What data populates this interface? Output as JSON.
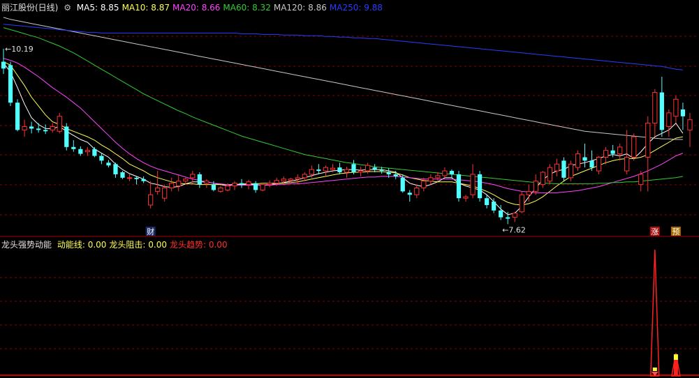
{
  "header": {
    "stock_name": "丽江股份(日线)",
    "ma": [
      {
        "label": "MA5:",
        "value": "8.85",
        "color": "#ffffff"
      },
      {
        "label": "MA10:",
        "value": "8.87",
        "color": "#ffff55"
      },
      {
        "label": "MA20:",
        "value": "8.66",
        "color": "#ff44ff"
      },
      {
        "label": "MA60:",
        "value": "8.32",
        "color": "#33cc33"
      },
      {
        "label": "MA120:",
        "value": "8.86",
        "color": "#c8c8c8"
      },
      {
        "label": "MA250:",
        "value": "9.88",
        "color": "#2a3cff"
      }
    ]
  },
  "indicator": {
    "name": "龙头强势动能",
    "items": [
      {
        "label": "动能线:",
        "value": "0.00",
        "color": "#ffff55"
      },
      {
        "label": "龙头阻击:",
        "value": "0.00",
        "color": "#ffff55"
      },
      {
        "label": "龙头趋势:",
        "value": "0.00",
        "color": "#ff3030"
      }
    ]
  },
  "annotations": {
    "high": "10.19",
    "low": "7.62",
    "marker_cai": "财",
    "marker_zhang": "涨",
    "marker_yu": "预"
  },
  "chart_data": {
    "type": "candlestick",
    "up_color": "#ff3232",
    "down_color": "#54ffff",
    "price_range": [
      7.45,
      10.7
    ],
    "candles": [
      [
        10.0,
        10.19,
        9.82,
        9.9
      ],
      [
        9.95,
        10.0,
        9.35,
        9.4
      ],
      [
        9.4,
        9.45,
        8.98,
        9.0
      ],
      [
        9.0,
        9.15,
        8.9,
        9.05
      ],
      [
        9.05,
        9.12,
        8.95,
        9.02
      ],
      [
        9.02,
        9.1,
        8.96,
        9.0
      ],
      [
        9.0,
        9.08,
        8.94,
        8.98
      ],
      [
        9.0,
        9.1,
        8.96,
        9.05
      ],
      [
        8.98,
        9.25,
        8.95,
        9.2
      ],
      [
        9.05,
        9.1,
        8.7,
        8.75
      ],
      [
        8.75,
        8.85,
        8.68,
        8.72
      ],
      [
        8.72,
        8.76,
        8.62,
        8.65
      ],
      [
        8.68,
        8.75,
        8.62,
        8.7
      ],
      [
        8.72,
        8.75,
        8.6,
        8.62
      ],
      [
        8.62,
        8.66,
        8.5,
        8.55
      ],
      [
        8.52,
        8.56,
        8.45,
        8.48
      ],
      [
        8.5,
        8.52,
        8.3,
        8.35
      ],
      [
        8.38,
        8.4,
        8.28,
        8.3
      ],
      [
        8.3,
        8.35,
        8.25,
        8.3
      ],
      [
        8.3,
        8.32,
        8.2,
        8.28
      ],
      [
        8.28,
        8.32,
        8.22,
        8.25
      ],
      [
        7.9,
        8.25,
        7.85,
        8.05
      ],
      [
        8.1,
        8.4,
        8.05,
        8.15
      ],
      [
        8.0,
        8.2,
        7.95,
        8.15
      ],
      [
        8.15,
        8.3,
        8.1,
        8.22
      ],
      [
        8.18,
        8.35,
        8.1,
        8.25
      ],
      [
        8.25,
        8.3,
        8.2,
        8.28
      ],
      [
        8.3,
        8.4,
        8.22,
        8.35
      ],
      [
        8.35,
        8.38,
        8.15,
        8.2
      ],
      [
        8.22,
        8.28,
        8.15,
        8.25
      ],
      [
        8.2,
        8.25,
        8.1,
        8.12
      ],
      [
        8.1,
        8.18,
        8.08,
        8.15
      ],
      [
        8.12,
        8.22,
        8.1,
        8.18
      ],
      [
        8.18,
        8.25,
        8.12,
        8.22
      ],
      [
        8.22,
        8.28,
        8.15,
        8.2
      ],
      [
        8.2,
        8.27,
        8.13,
        8.24
      ],
      [
        8.22,
        8.25,
        8.08,
        8.12
      ],
      [
        8.12,
        8.22,
        8.1,
        8.2
      ],
      [
        8.2,
        8.26,
        8.16,
        8.22
      ],
      [
        8.22,
        8.3,
        8.18,
        8.26
      ],
      [
        8.25,
        8.32,
        8.2,
        8.28
      ],
      [
        8.26,
        8.3,
        8.22,
        8.28
      ],
      [
        8.28,
        8.35,
        8.2,
        8.3
      ],
      [
        8.3,
        8.38,
        8.25,
        8.35
      ],
      [
        8.35,
        8.48,
        8.3,
        8.42
      ],
      [
        8.42,
        8.5,
        8.35,
        8.4
      ],
      [
        8.4,
        8.48,
        8.32,
        8.45
      ],
      [
        8.42,
        8.5,
        8.38,
        8.44
      ],
      [
        8.45,
        8.52,
        8.35,
        8.38
      ],
      [
        8.38,
        8.46,
        8.3,
        8.42
      ],
      [
        8.5,
        8.56,
        8.35,
        8.38
      ],
      [
        8.38,
        8.46,
        8.32,
        8.4
      ],
      [
        8.4,
        8.52,
        8.36,
        8.48
      ],
      [
        8.45,
        8.5,
        8.38,
        8.42
      ],
      [
        8.42,
        8.46,
        8.36,
        8.4
      ],
      [
        8.38,
        8.44,
        8.3,
        8.35
      ],
      [
        8.35,
        8.4,
        8.28,
        8.32
      ],
      [
        8.3,
        8.35,
        8.08,
        8.1
      ],
      [
        8.08,
        8.12,
        7.95,
        8.05
      ],
      [
        8.05,
        8.2,
        8.0,
        8.15
      ],
      [
        8.15,
        8.3,
        8.1,
        8.25
      ],
      [
        8.25,
        8.35,
        8.2,
        8.3
      ],
      [
        8.3,
        8.38,
        8.25,
        8.33
      ],
      [
        8.33,
        8.45,
        8.3,
        8.4
      ],
      [
        8.4,
        8.42,
        8.3,
        8.35
      ],
      [
        8.35,
        8.4,
        7.95,
        8.0
      ],
      [
        8.0,
        8.05,
        7.95,
        8.02
      ],
      [
        8.05,
        8.5,
        8.0,
        8.35
      ],
      [
        8.35,
        8.4,
        7.95,
        8.0
      ],
      [
        8.0,
        8.05,
        7.85,
        7.9
      ],
      [
        7.95,
        8.0,
        7.78,
        7.82
      ],
      [
        7.82,
        7.9,
        7.68,
        7.72
      ],
      [
        7.72,
        7.8,
        7.62,
        7.7
      ],
      [
        7.72,
        7.8,
        7.65,
        7.78
      ],
      [
        7.8,
        8.1,
        7.78,
        8.05
      ],
      [
        8.05,
        8.2,
        7.95,
        8.1
      ],
      [
        8.1,
        8.35,
        8.05,
        8.25
      ],
      [
        8.2,
        8.4,
        8.15,
        8.38
      ],
      [
        8.25,
        8.5,
        8.2,
        8.45
      ],
      [
        8.4,
        8.58,
        8.32,
        8.5
      ],
      [
        8.55,
        8.6,
        8.25,
        8.3
      ],
      [
        8.3,
        8.55,
        8.25,
        8.5
      ],
      [
        8.45,
        8.7,
        8.4,
        8.65
      ],
      [
        8.6,
        8.8,
        8.45,
        8.55
      ],
      [
        8.55,
        8.7,
        8.4,
        8.45
      ],
      [
        8.4,
        8.62,
        8.35,
        8.6
      ],
      [
        8.6,
        8.75,
        8.5,
        8.7
      ],
      [
        8.7,
        8.78,
        8.6,
        8.65
      ],
      [
        8.65,
        8.8,
        8.55,
        8.75
      ],
      [
        8.4,
        9.0,
        8.35,
        8.6
      ],
      [
        8.6,
        8.95,
        8.55,
        8.9
      ],
      [
        8.2,
        8.4,
        8.1,
        8.35
      ],
      [
        8.6,
        9.2,
        8.1,
        9.1
      ],
      [
        9.1,
        9.6,
        8.9,
        9.55
      ],
      [
        9.55,
        9.78,
        8.9,
        9.0
      ],
      [
        9.05,
        9.3,
        8.9,
        9.25
      ],
      [
        9.2,
        9.5,
        9.1,
        9.45
      ],
      [
        9.3,
        9.4,
        9.0,
        9.2
      ],
      [
        9.0,
        9.25,
        8.75,
        9.15
      ]
    ],
    "series": [
      {
        "name": "MA5",
        "color": "#ffffff",
        "values": [
          9.98,
          9.85,
          9.62,
          9.38,
          9.18,
          9.08,
          9.02,
          9.02,
          9.05,
          8.98,
          8.92,
          8.86,
          8.82,
          8.72,
          8.66,
          8.6,
          8.5,
          8.42,
          8.36,
          8.32,
          8.28,
          8.22,
          8.2,
          8.17,
          8.16,
          8.17,
          8.21,
          8.24,
          8.24,
          8.24,
          8.22,
          8.2,
          8.18,
          8.2,
          8.2,
          8.2,
          8.2,
          8.19,
          8.2,
          8.21,
          8.23,
          8.25,
          8.27,
          8.3,
          8.33,
          8.36,
          8.38,
          8.4,
          8.41,
          8.42,
          8.42,
          8.41,
          8.42,
          8.42,
          8.42,
          8.4,
          8.38,
          8.3,
          8.22,
          8.19,
          8.17,
          8.2,
          8.24,
          8.3,
          8.3,
          8.22,
          8.18,
          8.15,
          8.12,
          8.05,
          7.95,
          7.84,
          7.76,
          7.78,
          7.88,
          8.02,
          8.15,
          8.27,
          8.35,
          8.4,
          8.42,
          8.48,
          8.5,
          8.52,
          8.55,
          8.58,
          8.62,
          8.64,
          8.62,
          8.65,
          8.58,
          8.68,
          8.8,
          8.9,
          8.95,
          9.0,
          9.1,
          8.95
        ]
      },
      {
        "name": "MA10",
        "color": "#ffff55",
        "values": [
          10.0,
          9.95,
          9.8,
          9.65,
          9.48,
          9.35,
          9.22,
          9.12,
          9.08,
          9.02,
          8.98,
          8.94,
          8.9,
          8.85,
          8.78,
          8.72,
          8.65,
          8.58,
          8.5,
          8.45,
          8.4,
          8.34,
          8.3,
          8.27,
          8.24,
          8.22,
          8.21,
          8.21,
          8.2,
          8.2,
          8.2,
          8.2,
          8.2,
          8.2,
          8.21,
          8.21,
          8.21,
          8.22,
          8.22,
          8.22,
          8.22,
          8.23,
          8.24,
          8.26,
          8.28,
          8.3,
          8.32,
          8.34,
          8.36,
          8.37,
          8.38,
          8.38,
          8.39,
          8.39,
          8.39,
          8.38,
          8.37,
          8.34,
          8.3,
          8.28,
          8.26,
          8.25,
          8.24,
          8.24,
          8.24,
          8.22,
          8.2,
          8.18,
          8.14,
          8.1,
          8.05,
          7.99,
          7.94,
          7.91,
          7.9,
          7.92,
          7.96,
          8.02,
          8.1,
          8.18,
          8.25,
          8.32,
          8.36,
          8.4,
          8.44,
          8.48,
          8.52,
          8.55,
          8.57,
          8.58,
          8.58,
          8.6,
          8.64,
          8.7,
          8.76,
          8.82,
          8.88,
          8.9
        ]
      },
      {
        "name": "MA20",
        "color": "#ff44ff",
        "values": [
          10.05,
          10.02,
          9.98,
          9.92,
          9.85,
          9.78,
          9.7,
          9.62,
          9.55,
          9.48,
          9.4,
          9.32,
          9.22,
          9.12,
          9.02,
          8.92,
          8.82,
          8.73,
          8.65,
          8.58,
          8.52,
          8.47,
          8.43,
          8.4,
          8.37,
          8.34,
          8.31,
          8.28,
          8.26,
          8.24,
          8.22,
          8.21,
          8.2,
          8.19,
          8.19,
          8.19,
          8.19,
          8.19,
          8.19,
          8.2,
          8.2,
          8.21,
          8.21,
          8.22,
          8.23,
          8.24,
          8.25,
          8.26,
          8.27,
          8.28,
          8.29,
          8.3,
          8.31,
          8.31,
          8.32,
          8.32,
          8.32,
          8.31,
          8.3,
          8.29,
          8.28,
          8.28,
          8.28,
          8.28,
          8.28,
          8.27,
          8.26,
          8.25,
          8.24,
          8.22,
          8.2,
          8.17,
          8.14,
          8.12,
          8.1,
          8.09,
          8.08,
          8.08,
          8.08,
          8.08,
          8.09,
          8.1,
          8.11,
          8.13,
          8.15,
          8.17,
          8.2,
          8.23,
          8.26,
          8.29,
          8.32,
          8.36,
          8.4,
          8.45,
          8.5,
          8.56,
          8.62,
          8.66
        ]
      },
      {
        "name": "MA60",
        "color": "#33cc33",
        "values": [
          10.5,
          10.47,
          10.44,
          10.41,
          10.38,
          10.35,
          10.31,
          10.27,
          10.23,
          10.18,
          10.13,
          10.07,
          10.01,
          9.95,
          9.89,
          9.83,
          9.77,
          9.71,
          9.65,
          9.59,
          9.53,
          9.48,
          9.43,
          9.38,
          9.33,
          9.28,
          9.24,
          9.19,
          9.15,
          9.11,
          9.07,
          9.03,
          8.99,
          8.95,
          8.91,
          8.88,
          8.85,
          8.82,
          8.79,
          8.76,
          8.73,
          8.7,
          8.67,
          8.64,
          8.62,
          8.6,
          8.58,
          8.56,
          8.54,
          8.52,
          8.51,
          8.49,
          8.48,
          8.46,
          8.45,
          8.44,
          8.43,
          8.42,
          8.41,
          8.4,
          8.39,
          8.38,
          8.37,
          8.36,
          8.35,
          8.34,
          8.33,
          8.32,
          8.31,
          8.3,
          8.29,
          8.28,
          8.27,
          8.26,
          8.25,
          8.24,
          8.23,
          8.22,
          8.22,
          8.21,
          8.21,
          8.21,
          8.21,
          8.21,
          8.21,
          8.22,
          8.22,
          8.23,
          8.23,
          8.24,
          8.24,
          8.25,
          8.26,
          8.27,
          8.28,
          8.29,
          8.3,
          8.32
        ]
      },
      {
        "name": "MA120",
        "color": "#c8c8c8",
        "values": [
          10.65,
          10.62,
          10.6,
          10.58,
          10.56,
          10.54,
          10.52,
          10.5,
          10.48,
          10.46,
          10.44,
          10.42,
          10.4,
          10.38,
          10.36,
          10.34,
          10.32,
          10.3,
          10.28,
          10.26,
          10.24,
          10.22,
          10.2,
          10.18,
          10.16,
          10.14,
          10.12,
          10.1,
          10.08,
          10.06,
          10.04,
          10.02,
          10.0,
          9.98,
          9.96,
          9.94,
          9.92,
          9.9,
          9.88,
          9.86,
          9.84,
          9.82,
          9.8,
          9.78,
          9.76,
          9.74,
          9.72,
          9.7,
          9.68,
          9.66,
          9.64,
          9.62,
          9.6,
          9.58,
          9.56,
          9.54,
          9.52,
          9.5,
          9.48,
          9.46,
          9.44,
          9.42,
          9.4,
          9.38,
          9.36,
          9.34,
          9.32,
          9.3,
          9.28,
          9.26,
          9.24,
          9.22,
          9.2,
          9.18,
          9.16,
          9.14,
          9.12,
          9.1,
          9.08,
          9.06,
          9.04,
          9.02,
          9.0,
          8.98,
          8.97,
          8.96,
          8.95,
          8.94,
          8.93,
          8.92,
          8.91,
          8.9,
          8.89,
          8.88,
          8.87,
          8.87,
          8.86,
          8.86
        ]
      },
      {
        "name": "MA250",
        "color": "#2a3cff",
        "values": [
          10.55,
          10.54,
          10.53,
          10.52,
          10.51,
          10.5,
          10.49,
          10.48,
          10.47,
          10.46,
          10.45,
          10.44,
          10.43,
          10.43,
          10.42,
          10.42,
          10.42,
          10.42,
          10.42,
          10.42,
          10.42,
          10.42,
          10.42,
          10.42,
          10.42,
          10.42,
          10.42,
          10.42,
          10.42,
          10.42,
          10.42,
          10.42,
          10.42,
          10.42,
          10.41,
          10.41,
          10.41,
          10.4,
          10.4,
          10.4,
          10.39,
          10.39,
          10.39,
          10.38,
          10.38,
          10.38,
          10.37,
          10.37,
          10.36,
          10.36,
          10.35,
          10.35,
          10.34,
          10.34,
          10.33,
          10.32,
          10.31,
          10.3,
          10.29,
          10.28,
          10.27,
          10.26,
          10.25,
          10.24,
          10.23,
          10.22,
          10.21,
          10.2,
          10.19,
          10.18,
          10.17,
          10.16,
          10.15,
          10.14,
          10.13,
          10.12,
          10.11,
          10.1,
          10.09,
          10.08,
          10.07,
          10.06,
          10.05,
          10.04,
          10.03,
          10.02,
          10.01,
          10.0,
          9.99,
          9.98,
          9.97,
          9.96,
          9.95,
          9.94,
          9.93,
          9.91,
          9.89,
          9.88
        ]
      }
    ],
    "indicator_spikes": [
      {
        "index": 93,
        "height": 1.0,
        "color": "#ff2020"
      },
      {
        "index": 96,
        "height": 0.18,
        "color": "#ff2020"
      }
    ],
    "grid": true
  }
}
